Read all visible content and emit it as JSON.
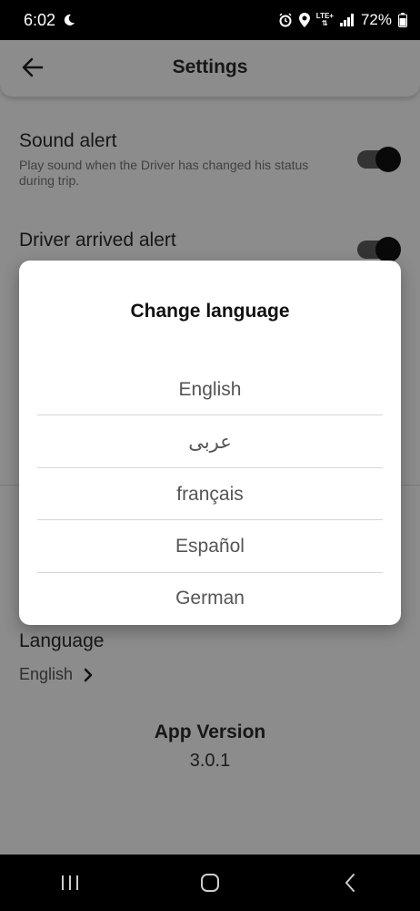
{
  "status_bar": {
    "time": "6:02",
    "network": "LTE+",
    "battery": "72%"
  },
  "app_bar": {
    "title": "Settings"
  },
  "settings": {
    "sound_alert": {
      "title": "Sound alert",
      "description": "Play sound when the Driver has changed his status during trip.",
      "enabled": true
    },
    "driver_arrived_alert": {
      "title": "Driver arrived alert",
      "enabled": true
    },
    "language": {
      "title": "Language",
      "value": "English"
    },
    "app_version": {
      "title": "App Version",
      "value": "3.0.1"
    }
  },
  "dialog": {
    "title": "Change language",
    "options": [
      "English",
      "عربى",
      "français",
      "Español",
      "German"
    ]
  },
  "colors": {
    "overlay": "#000000",
    "toggle_on": "#111111"
  }
}
